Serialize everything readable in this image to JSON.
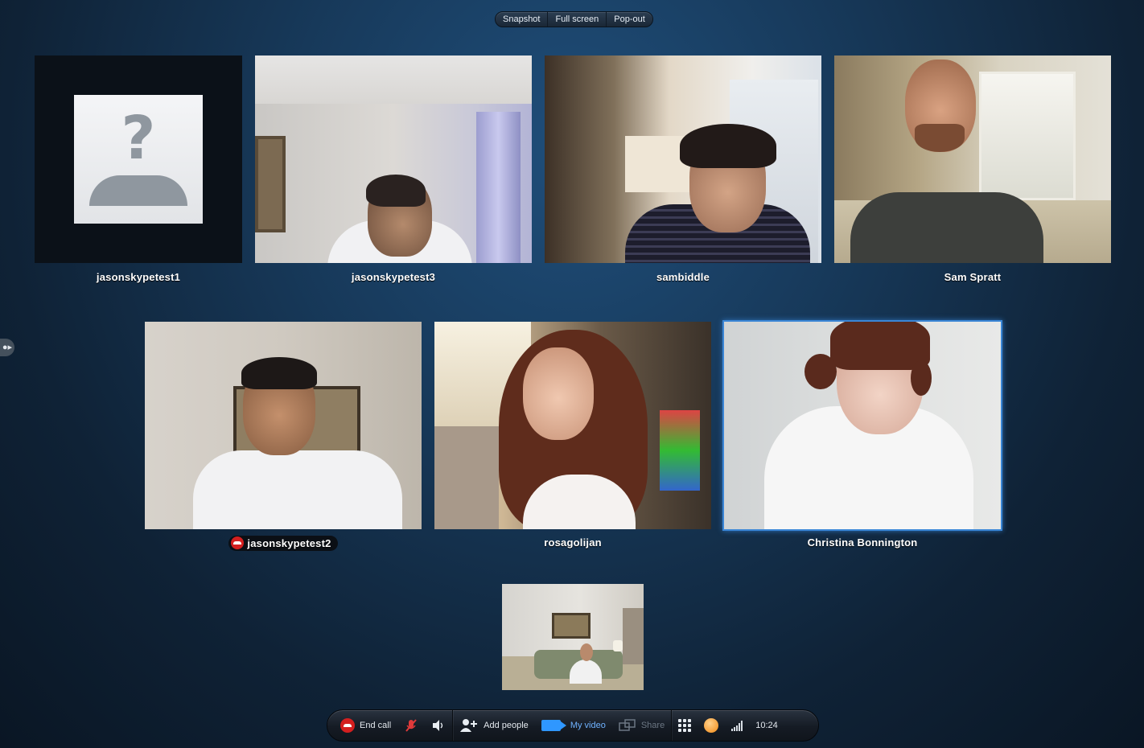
{
  "top_bar": {
    "buttons": [
      "Snapshot",
      "Full screen",
      "Pop-out"
    ]
  },
  "participants": [
    {
      "name": "jasonskypetest1",
      "video": false
    },
    {
      "name": "jasonskypetest3",
      "video": true
    },
    {
      "name": "sambiddle",
      "video": true
    },
    {
      "name": "Sam Spratt",
      "video": true
    },
    {
      "name": "jasonskypetest2",
      "video": true,
      "call_ended_badge": true
    },
    {
      "name": "rosagolijan",
      "video": true
    },
    {
      "name": "Christina Bonnington",
      "video": true,
      "selected": true
    }
  ],
  "self_view": {
    "label": "My video preview"
  },
  "call_bar": {
    "end_call": "End call",
    "add_people": "Add people",
    "my_video": "My video",
    "share": "Share",
    "time": "10:24"
  },
  "colors": {
    "background_top": "#1f4e7a",
    "background_bottom": "#0a1624",
    "selected_border": "#3a86d6",
    "end_call_red": "#d41f1f",
    "video_blue": "#2f97ff",
    "status_orange": "#f28a16"
  },
  "icons": [
    "end-call-icon",
    "mute-mic-icon",
    "speaker-icon",
    "add-person-icon",
    "video-camera-icon",
    "share-screen-icon",
    "dialpad-icon",
    "status-icon",
    "signal-strength-icon",
    "contacts-handle-icon"
  ]
}
